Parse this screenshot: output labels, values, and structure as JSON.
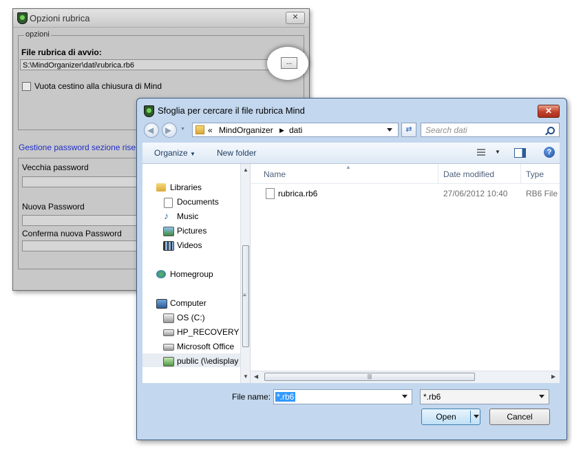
{
  "back_window": {
    "title": "Opzioni rubrica",
    "close_glyph": "✕",
    "group_label": "opzioni",
    "file_label": "File rubrica di avvio:",
    "file_value": "S:\\MindOrganizer\\dati\\rubrica.rb6",
    "browse_label": "...",
    "checkbox_label": "Vuota cestino alla chiusura di Mind",
    "password_link": "Gestione password sezione riservata",
    "old_password_label": "Vecchia password",
    "new_password_label": "Nuova Password",
    "confirm_password_label": "Conferma nuova Password"
  },
  "dialog": {
    "title": "Sfoglia per cercare il file rubrica Mind",
    "close_glyph": "✕",
    "breadcrumb": [
      "«",
      "MindOrganizer",
      "dati"
    ],
    "search_placeholder": "Search dati",
    "toolbar": {
      "organize": "Organize",
      "new_folder": "New folder",
      "help_glyph": "?"
    },
    "nav": {
      "libraries": "Libraries",
      "documents": "Documents",
      "music": "Music",
      "pictures": "Pictures",
      "videos": "Videos",
      "homegroup": "Homegroup",
      "computer": "Computer",
      "os_c": "OS (C:)",
      "hp_recovery": "HP_RECOVERY (D",
      "ms_office": "Microsoft Office",
      "public": "public (\\\\edisplay"
    },
    "columns": {
      "name": "Name",
      "date_modified": "Date modified",
      "type": "Type"
    },
    "files": [
      {
        "name": "rubrica.rb6",
        "date": "27/06/2012 10:40",
        "type": "RB6 File"
      }
    ],
    "file_name_label": "File name:",
    "file_name_value": "*.rb6",
    "file_type_value": "*.rb6",
    "open_label": "Open",
    "cancel_label": "Cancel"
  },
  "colors": {
    "accent": "#3399ff",
    "link": "#1f2dc8",
    "dialog_frame": "#c3d7ee",
    "close_red": "#c1412a"
  }
}
